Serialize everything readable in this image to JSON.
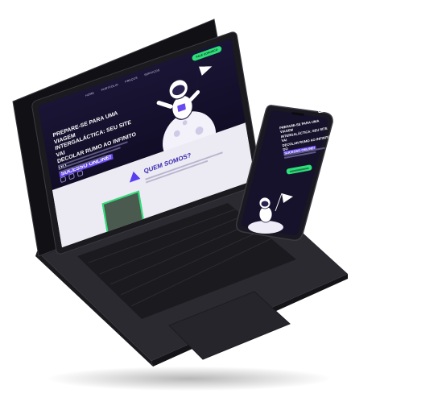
{
  "laptop": {
    "nav": [
      "HOME",
      "PORTFÓLIO",
      "PREÇOS",
      "SERVIÇOS"
    ],
    "cta": "FALE CONOSCO",
    "headline_line1": "PREPARE-SE PARA UMA VIAGEM",
    "headline_line2": "INTERGALÁCTICA: SEU SITE VAI",
    "headline_line3": "DECOLAR RUMO AO INFINITO DO",
    "headline_highlight": "SUCESSO ONLINE!",
    "about_title": "QUEM SOMOS?"
  },
  "phone": {
    "headline_line1": "PREPARE-SE PARA UMA VIAGEM",
    "headline_line2": "INTERGALÁCTICA: SEU SITE VAI",
    "headline_line3": "DECOLAR RUMO AO INFINITO DO",
    "headline_highlight": "SUCESSO ONLINE!"
  },
  "colors": {
    "hero_bg": "#13102a",
    "accent_green": "#2ee07a",
    "accent_purple": "#6a4bf0",
    "device_body": "#2b2a30"
  }
}
